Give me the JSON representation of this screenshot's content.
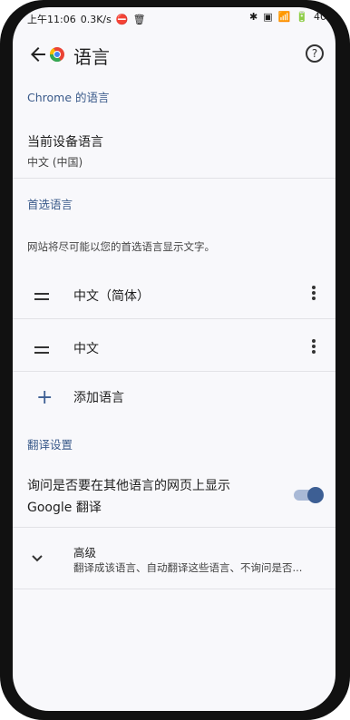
{
  "status_bar": {
    "time": "上午11:06",
    "speed": "0.3K/s",
    "battery": "40"
  },
  "app_bar": {
    "title": "语言",
    "back_icon": "back-arrow-icon",
    "help_icon": "help-circle-icon"
  },
  "sections": {
    "chrome_language": "Chrome 的语言",
    "preferred": "首选语言",
    "translate": "翻译设置"
  },
  "device_language": {
    "title": "当前设备语言",
    "value": "中文 (中国)"
  },
  "preferred_description": "网站将尽可能以您的首选语言显示文字。",
  "preferred_languages": [
    {
      "name": "中文（简体）"
    },
    {
      "name": "中文"
    }
  ],
  "add_language": {
    "label": "添加语言"
  },
  "translate_toggle": {
    "label_line1": "询问是否要在其他语言的网页上显示",
    "label_line2": "Google 翻译",
    "enabled": true
  },
  "advanced": {
    "title": "高级",
    "subtitle": "翻译成该语言、自动翻译这些语言、不询问是否..."
  }
}
